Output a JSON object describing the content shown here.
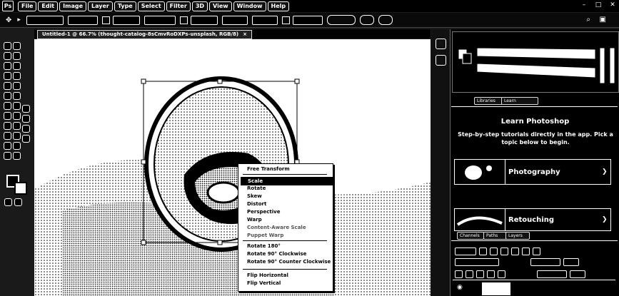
{
  "app": {
    "logo": "Ps"
  },
  "menus": [
    "File",
    "Edit",
    "Image",
    "Layer",
    "Type",
    "Select",
    "Filter",
    "3D",
    "View",
    "Window",
    "Help"
  ],
  "document_tab": {
    "title": "Untitled-1 @ 66.7% (thought-catalog-8sCmvRoDXPs-unsplash, RGB/8)",
    "close": "×"
  },
  "context_menu": {
    "items": [
      "Free Transform",
      "Scale",
      "Rotate",
      "Skew",
      "Distort",
      "Perspective",
      "Warp",
      "Content-Aware Scale",
      "Puppet Warp",
      "Rotate 180°",
      "Rotate 90° Clockwise",
      "Rotate 90° Counter Clockwise",
      "Flip Horizontal",
      "Flip Vertical"
    ],
    "selected": "Scale"
  },
  "learn_panel": {
    "tabs": [
      "Libraries",
      "Learn"
    ],
    "title": "Learn Photoshop",
    "body": "Step-by-step tutorials directly in the app. Pick a topic below to begin.",
    "cards": [
      {
        "label": "Photography"
      },
      {
        "label": "Retouching"
      }
    ]
  },
  "layers_panel": {
    "tabs": [
      "Channels",
      "Paths",
      "Layers"
    ]
  },
  "icons": [
    "search-icon",
    "arrange-icon",
    "minimize-icon",
    "maximize-icon",
    "close-icon",
    "move-tool-icon",
    "chevron-right-icon",
    "eye-icon",
    "lock-icon",
    "link-icon",
    "fx-icon",
    "mask-icon",
    "adjustment-icon",
    "folder-icon",
    "new-layer-icon",
    "trash-icon"
  ]
}
